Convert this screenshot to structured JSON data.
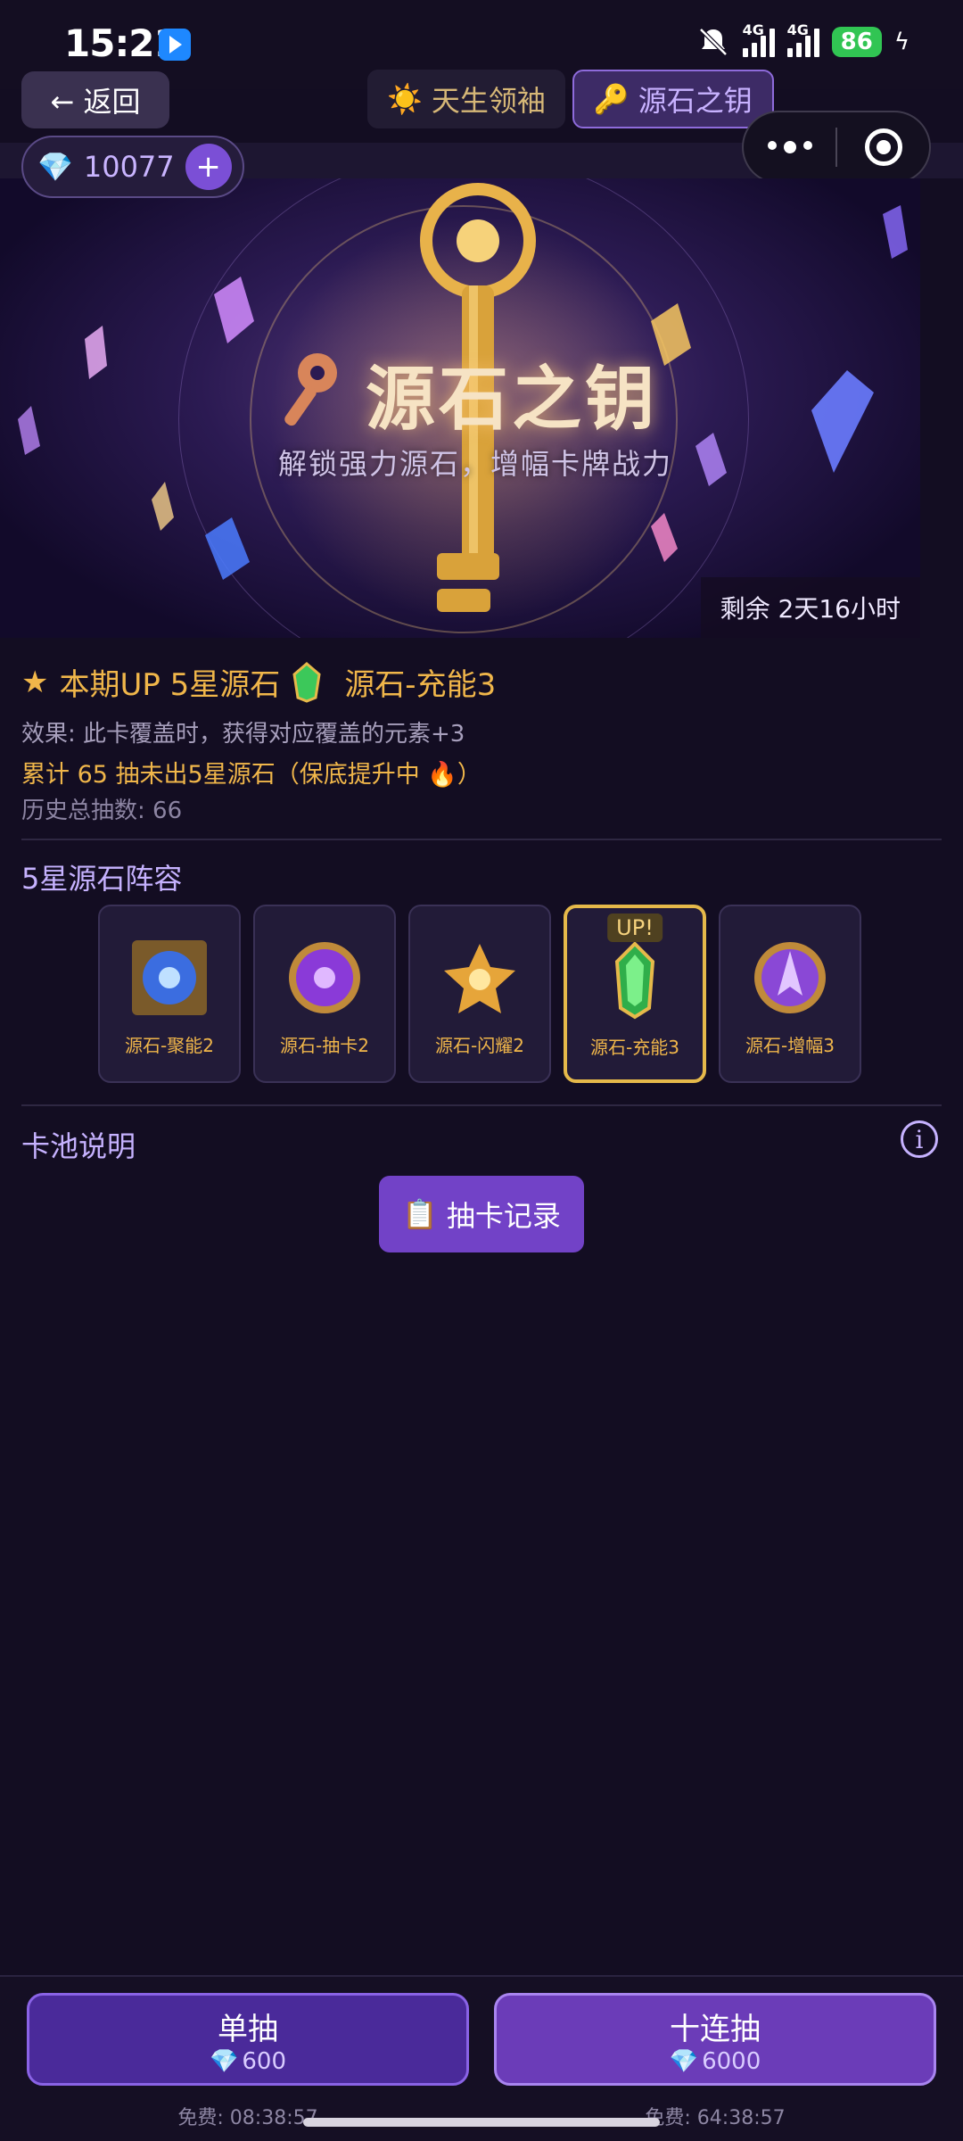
{
  "status_bar": {
    "time": "15:21",
    "battery": "86",
    "net1": "4G",
    "net2": "4G"
  },
  "header": {
    "back_label": "← 返回",
    "tabs": [
      {
        "icon": "☀️",
        "label": "天生领袖"
      },
      {
        "icon": "🔑",
        "label": "源石之钥"
      }
    ]
  },
  "balance": {
    "gem_icon": "💎",
    "amount": "10077",
    "plus": "+"
  },
  "banner": {
    "key_icon": "🔑",
    "title": "源石之钥",
    "subtitle": "解锁强力源石，增幅卡牌战力",
    "remaining": "剩余 2天16小时"
  },
  "info": {
    "star_icon": "★",
    "up_label": "本期UP 5星源石",
    "up_item": "源石-充能3",
    "effect": "效果: 此卡覆盖时，获得对应覆盖的元素+3",
    "pity": "累计 65 抽未出5星源石（保底提升中 🔥）",
    "total": "历史总抽数: 66"
  },
  "lineup": {
    "title": "5星源石阵容",
    "items": [
      {
        "name": "源石-聚能2",
        "color": "#3b6de0"
      },
      {
        "name": "源石-抽卡2",
        "color": "#8a3ad8"
      },
      {
        "name": "源石-闪耀2",
        "color": "#e6a53a"
      },
      {
        "name": "源石-充能3",
        "color": "#2fae4a",
        "tag": "UP!"
      },
      {
        "name": "源石-增幅3",
        "color": "#8a48d6"
      }
    ]
  },
  "pool": {
    "title": "卡池说明",
    "info_icon": "i",
    "record_icon": "📋",
    "record_label": "抽卡记录"
  },
  "draws": {
    "single": {
      "label": "单抽",
      "gem": "💎",
      "cost": "600",
      "free": "免费: 08:38:57"
    },
    "ten": {
      "label": "十连抽",
      "gem": "💎",
      "cost": "6000",
      "free": "免费: 64:38:57"
    }
  }
}
